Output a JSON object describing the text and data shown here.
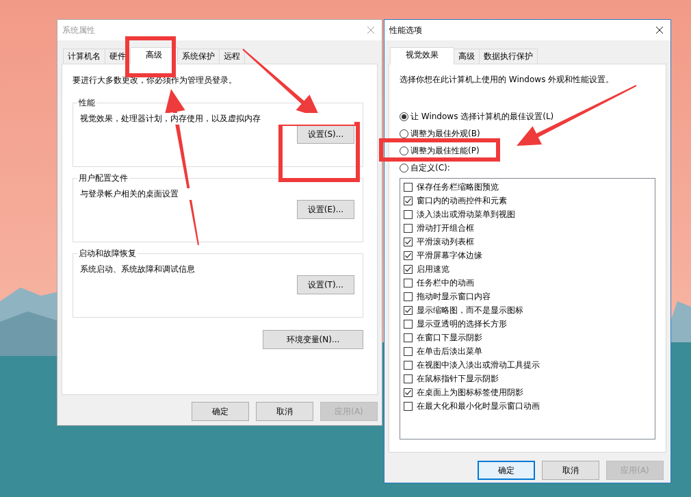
{
  "system_properties": {
    "title": "系统属性",
    "active": false,
    "tabs": [
      {
        "label": "计算机名",
        "selected": false
      },
      {
        "label": "硬件",
        "selected": false
      },
      {
        "label": "高级",
        "selected": true
      },
      {
        "label": "系统保护",
        "selected": false
      },
      {
        "label": "远程",
        "selected": false
      }
    ],
    "notice": "要进行大多数更改，你必须作为管理员登录。",
    "groups": [
      {
        "title": "性能",
        "description": "视觉效果，处理器计划，内存使用，以及虚拟内存",
        "button": "设置(S)..."
      },
      {
        "title": "用户配置文件",
        "description": "与登录帐户相关的桌面设置",
        "button": "设置(E)..."
      },
      {
        "title": "启动和故障恢复",
        "description": "系统启动、系统故障和调试信息",
        "button": "设置(T)..."
      }
    ],
    "env_button": "环境变量(N)...",
    "buttons": [
      {
        "label": "确定",
        "disabled": false,
        "default": false
      },
      {
        "label": "取消",
        "disabled": false,
        "default": false
      },
      {
        "label": "应用(A)",
        "disabled": true,
        "default": false
      }
    ]
  },
  "performance_options": {
    "title": "性能选项",
    "active": true,
    "tabs": [
      {
        "label": "视觉效果",
        "selected": true
      },
      {
        "label": "高级",
        "selected": false
      },
      {
        "label": "数据执行保护",
        "selected": false
      }
    ],
    "intro": "选择你想在此计算机上使用的 Windows 外观和性能设置。",
    "options": [
      {
        "label": "让 Windows 选择计算机的最佳设置(L)",
        "selected": true
      },
      {
        "label": "调整为最佳外观(B)",
        "selected": false
      },
      {
        "label": "调整为最佳性能(P)",
        "selected": false
      },
      {
        "label": "自定义(C):",
        "selected": false
      }
    ],
    "effects": [
      {
        "label": "保存任务栏缩略图预览",
        "checked": false
      },
      {
        "label": "窗口内的动画控件和元素",
        "checked": true
      },
      {
        "label": "淡入淡出或滑动菜单到视图",
        "checked": false
      },
      {
        "label": "滑动打开组合框",
        "checked": false
      },
      {
        "label": "平滑滚动列表框",
        "checked": true
      },
      {
        "label": "平滑屏幕字体边缘",
        "checked": true
      },
      {
        "label": "启用速览",
        "checked": true
      },
      {
        "label": "任务栏中的动画",
        "checked": false
      },
      {
        "label": "拖动时显示窗口内容",
        "checked": false
      },
      {
        "label": "显示缩略图，而不是显示图标",
        "checked": true
      },
      {
        "label": "显示亚透明的选择长方形",
        "checked": false
      },
      {
        "label": "在窗口下显示阴影",
        "checked": false
      },
      {
        "label": "在单击后淡出菜单",
        "checked": false
      },
      {
        "label": "在视图中淡入淡出或滑动工具提示",
        "checked": false
      },
      {
        "label": "在鼠标指针下显示阴影",
        "checked": false
      },
      {
        "label": "在桌面上为图标标签使用阴影",
        "checked": true
      },
      {
        "label": "在最大化和最小化时显示窗口动画",
        "checked": false
      }
    ],
    "buttons": [
      {
        "label": "确定",
        "disabled": false,
        "default": true
      },
      {
        "label": "取消",
        "disabled": false,
        "default": false
      },
      {
        "label": "应用(A)",
        "disabled": true,
        "default": false
      }
    ]
  },
  "annotations": [
    {
      "kind": "box"
    },
    {
      "kind": "box"
    },
    {
      "kind": "box"
    },
    {
      "kind": "arrow"
    },
    {
      "kind": "arrow"
    },
    {
      "kind": "arrow"
    }
  ]
}
